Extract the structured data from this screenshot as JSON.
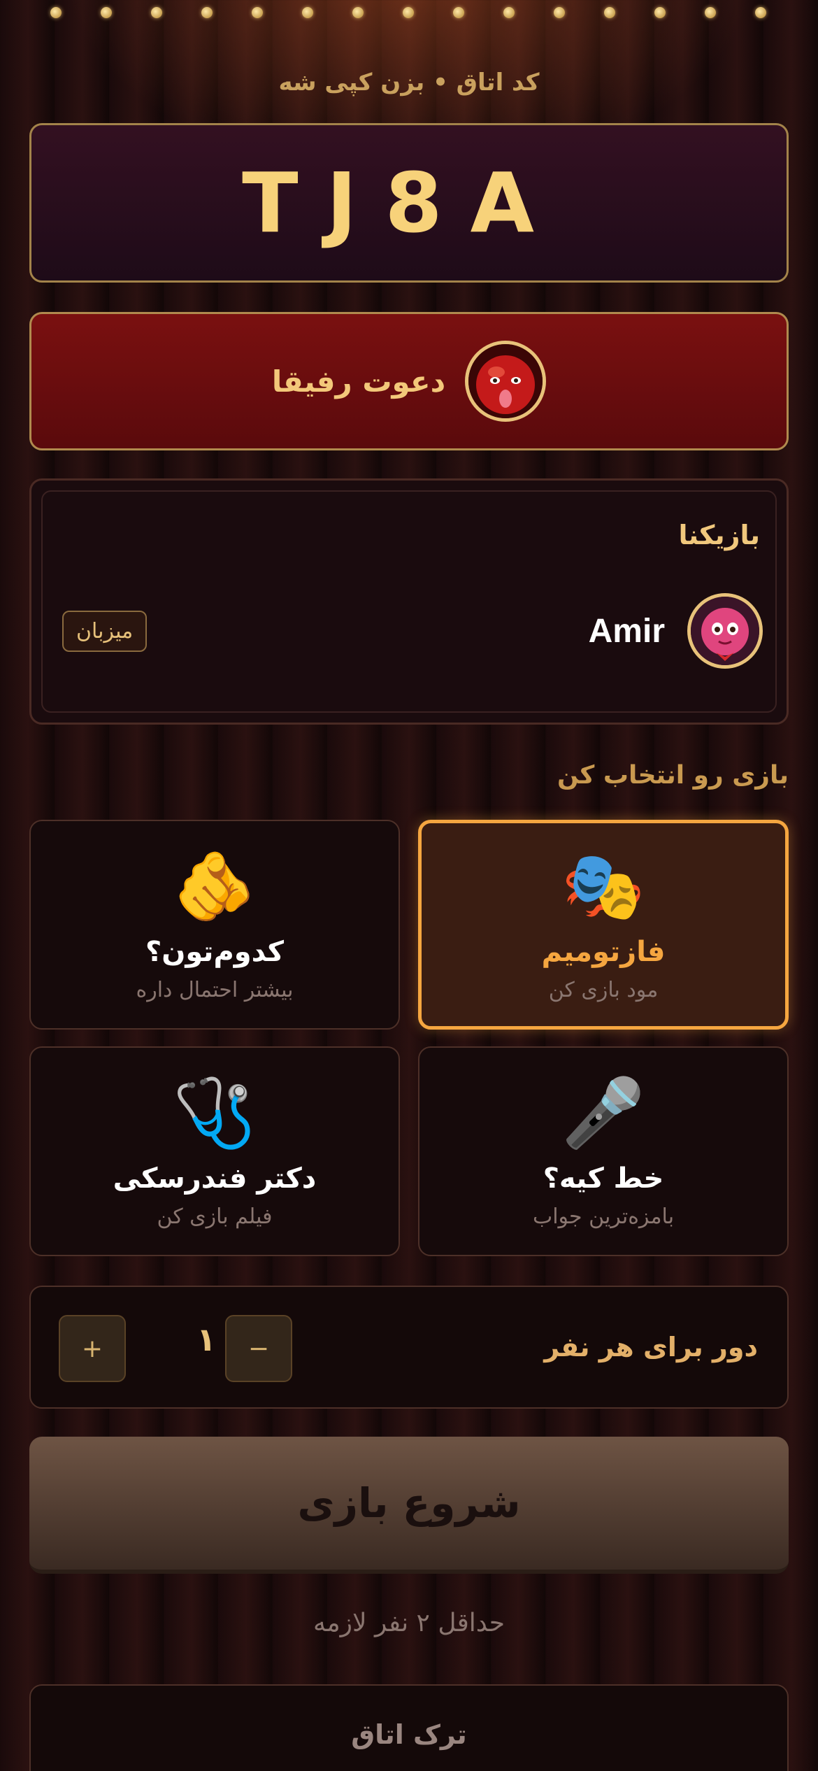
{
  "header": {
    "room_label": "کد اتاق • بزن کپی شه",
    "room_code": "TJ8A"
  },
  "invite": {
    "label": "دعوت رفیقا",
    "avatar_icon": "apple-face-avatar"
  },
  "players": {
    "title": "بازیکنا",
    "list": [
      {
        "name": "Amir",
        "badge": "میزبان",
        "avatar_icon": "pink-doll-avatar"
      }
    ]
  },
  "games": {
    "title": "بازی رو انتخاب کن",
    "items": [
      {
        "icon": "🎭",
        "icon_name": "theater-masks-icon",
        "title": "فازتومیم",
        "subtitle": "مود بازی کن",
        "selected": true
      },
      {
        "icon": "🫵",
        "icon_name": "pointing-finger-icon",
        "title": "کدوم‌تون؟",
        "subtitle": "بیشتر احتمال داره",
        "selected": false
      },
      {
        "icon": "🎤",
        "icon_name": "microphone-icon",
        "title": "خط کیه؟",
        "subtitle": "بامزه‌ترین جواب",
        "selected": false
      },
      {
        "icon": "🩺",
        "icon_name": "stethoscope-icon",
        "title": "دکتر فندرسکی",
        "subtitle": "فیلم بازی کن",
        "selected": false
      }
    ]
  },
  "rounds": {
    "label": "دور برای هر نفر",
    "value": "۱",
    "minus": "−",
    "plus": "+"
  },
  "start_button": "شروع بازی",
  "min_players_note": "حداقل ۲ نفر لازمه",
  "leave_button": "ترک اتاق",
  "colors": {
    "accent_gold": "#f5a640",
    "code_gold": "#f7d27a",
    "invite_red": "#7a1010"
  }
}
